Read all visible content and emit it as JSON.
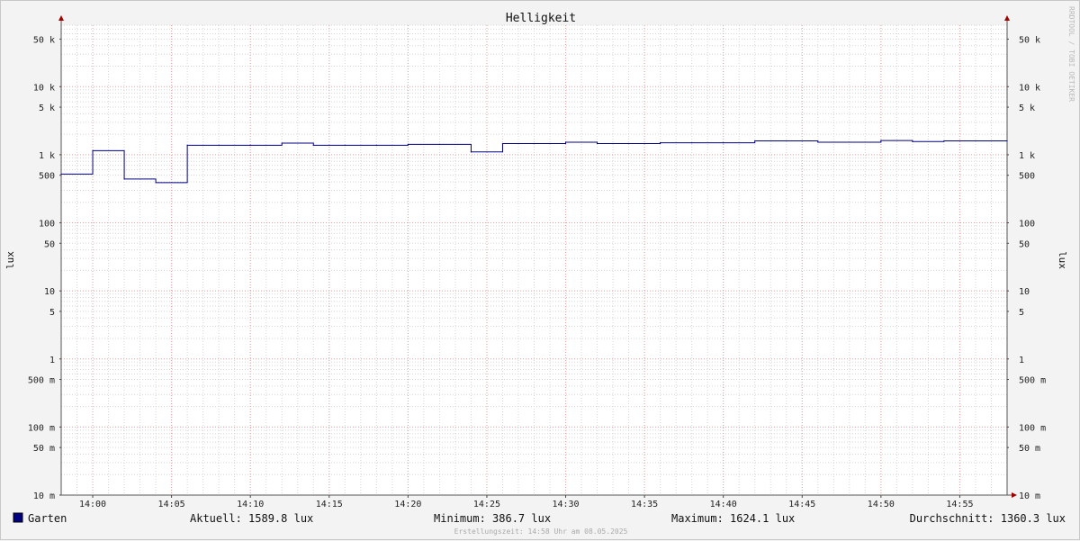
{
  "chart_data": {
    "type": "line",
    "title": "Helligkeit",
    "ylabel": "lux",
    "ylabel_right": "lux",
    "yscale": "log",
    "ylim": [
      0.01,
      80000
    ],
    "x_ticks": [
      "14:00",
      "14:05",
      "14:10",
      "14:15",
      "14:20",
      "14:25",
      "14:30",
      "14:35",
      "14:40",
      "14:45",
      "14:50",
      "14:55"
    ],
    "y_ticks": [
      {
        "value": 50000,
        "label": "50 k"
      },
      {
        "value": 10000,
        "label": "10 k"
      },
      {
        "value": 5000,
        "label": "5 k"
      },
      {
        "value": 1000,
        "label": "1 k"
      },
      {
        "value": 500,
        "label": "500"
      },
      {
        "value": 100,
        "label": "100"
      },
      {
        "value": 50,
        "label": "50"
      },
      {
        "value": 10,
        "label": "10"
      },
      {
        "value": 5,
        "label": "5"
      },
      {
        "value": 1,
        "label": "1"
      },
      {
        "value": 0.5,
        "label": "500 m"
      },
      {
        "value": 0.1,
        "label": "100 m"
      },
      {
        "value": 0.05,
        "label": "50 m"
      },
      {
        "value": 0.01,
        "label": "10 m"
      }
    ],
    "grid": true,
    "series": [
      {
        "name": "Garten",
        "color": "#000080",
        "x": [
          "13:58",
          "14:00",
          "14:02",
          "14:04",
          "14:06",
          "14:08",
          "14:10",
          "14:12",
          "14:14",
          "14:16",
          "14:18",
          "14:20",
          "14:22",
          "14:24",
          "14:26",
          "14:28",
          "14:30",
          "14:32",
          "14:34",
          "14:36",
          "14:38",
          "14:40",
          "14:42",
          "14:44",
          "14:46",
          "14:48",
          "14:50",
          "14:52",
          "14:54",
          "14:56",
          "14:58"
        ],
        "values": [
          520,
          1150,
          440,
          390,
          1380,
          1380,
          1380,
          1480,
          1380,
          1380,
          1380,
          1420,
          1420,
          1100,
          1460,
          1460,
          1530,
          1460,
          1460,
          1500,
          1500,
          1500,
          1600,
          1600,
          1530,
          1530,
          1620,
          1560,
          1600,
          1600,
          1600
        ]
      }
    ],
    "legend": {
      "series_label": "Garten",
      "current": "Aktuell: 1589.8 lux",
      "minimum": "Minimum: 386.7 lux",
      "maximum": "Maximum: 1624.1 lux",
      "average": "Durchschnitt: 1360.3 lux"
    },
    "watermark": "RRDTOOL / TOBI OETIKER",
    "footer": "Erstellungszeit: 14:58 Uhr am 08.05.2025"
  }
}
